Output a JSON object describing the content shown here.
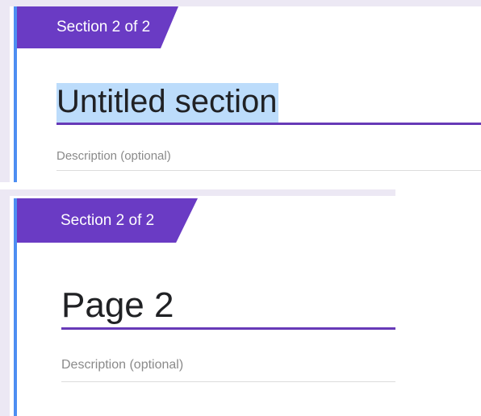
{
  "top_card": {
    "section_tab": "Section 2 of 2",
    "title": "Untitled section",
    "description_placeholder": "Description (optional)"
  },
  "bottom_card": {
    "section_tab": "Section 2 of 2",
    "title": "Page 2",
    "description_placeholder": "Description (optional)"
  },
  "colors": {
    "accent_purple": "#673ab7",
    "section_tab_bg": "#6a3bc4",
    "left_bar_blue": "#4d8ef2",
    "title_selection": "#bcdcfb",
    "page_bg_lavender": "#ece8f4"
  }
}
